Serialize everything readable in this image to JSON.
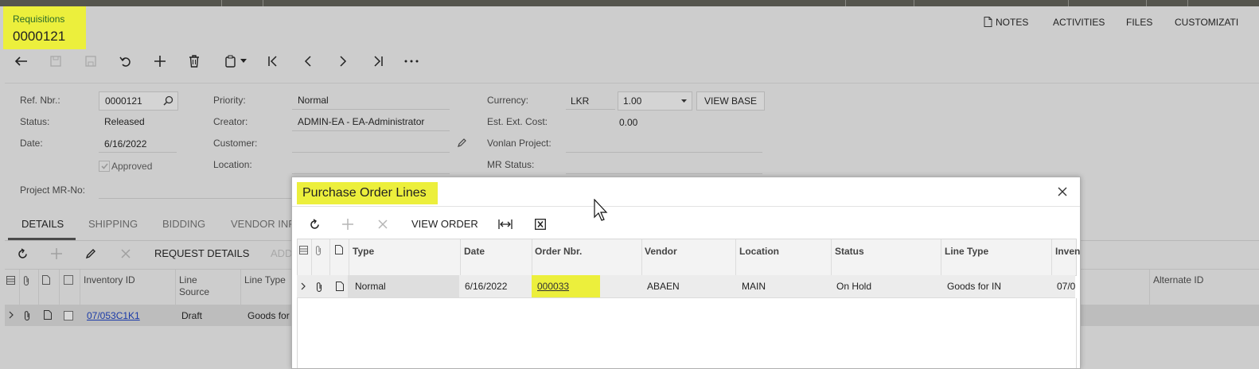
{
  "screen": {
    "title": "Requisitions",
    "number": "0000121"
  },
  "toplinks": {
    "notes": "NOTES",
    "activities": "ACTIVITIES",
    "files": "FILES",
    "customization": "CUSTOMIZATI"
  },
  "form": {
    "ref_nbr_label": "Ref. Nbr.:",
    "ref_nbr_value": "0000121",
    "status_label": "Status:",
    "status_value": "Released",
    "date_label": "Date:",
    "date_value": "6/16/2022",
    "approved_label": "Approved",
    "project_mr_label": "Project MR-No:",
    "priority_label": "Priority:",
    "priority_value": "Normal",
    "creator_label": "Creator:",
    "creator_value": "ADMIN-EA - EA-Administrator",
    "customer_label": "Customer:",
    "location_label": "Location:",
    "currency_label": "Currency:",
    "currency_value": "LKR",
    "currency_rate": "1.00",
    "view_base_label": "VIEW BASE",
    "est_cost_label": "Est. Ext. Cost:",
    "est_cost_value": "0.00",
    "vonlan_label": "Vonlan Project:",
    "mr_status_label": "MR Status:"
  },
  "tabs": [
    "DETAILS",
    "SHIPPING",
    "BIDDING",
    "VENDOR INF"
  ],
  "details_toolbar": {
    "request_details": "REQUEST DETAILS",
    "add_partial": "ADD"
  },
  "details_grid": {
    "headers": {
      "inventory_id": "Inventory ID",
      "line_source": "Line Source",
      "line_type": "Line Type",
      "alternate_id": "Alternate ID"
    },
    "row": {
      "inventory_id": "07/053C1K1",
      "line_source": "Draft",
      "line_type": "Goods for"
    }
  },
  "modal": {
    "title": "Purchase Order Lines",
    "view_order": "VIEW ORDER",
    "headers": {
      "type": "Type",
      "date": "Date",
      "order_nbr": "Order Nbr.",
      "vendor": "Vendor",
      "location": "Location",
      "status": "Status",
      "line_type": "Line Type",
      "inventory": "Inven"
    },
    "row": {
      "type": "Normal",
      "date": "6/16/2022",
      "order_nbr": "000033",
      "vendor": "ABAEN",
      "location": "MAIN",
      "status": "On Hold",
      "line_type": "Goods for IN",
      "inventory": "07/0"
    }
  },
  "colors": {
    "highlight": "#ecef3c",
    "link": "#1a3aa8",
    "background": "#cdcdcd"
  }
}
